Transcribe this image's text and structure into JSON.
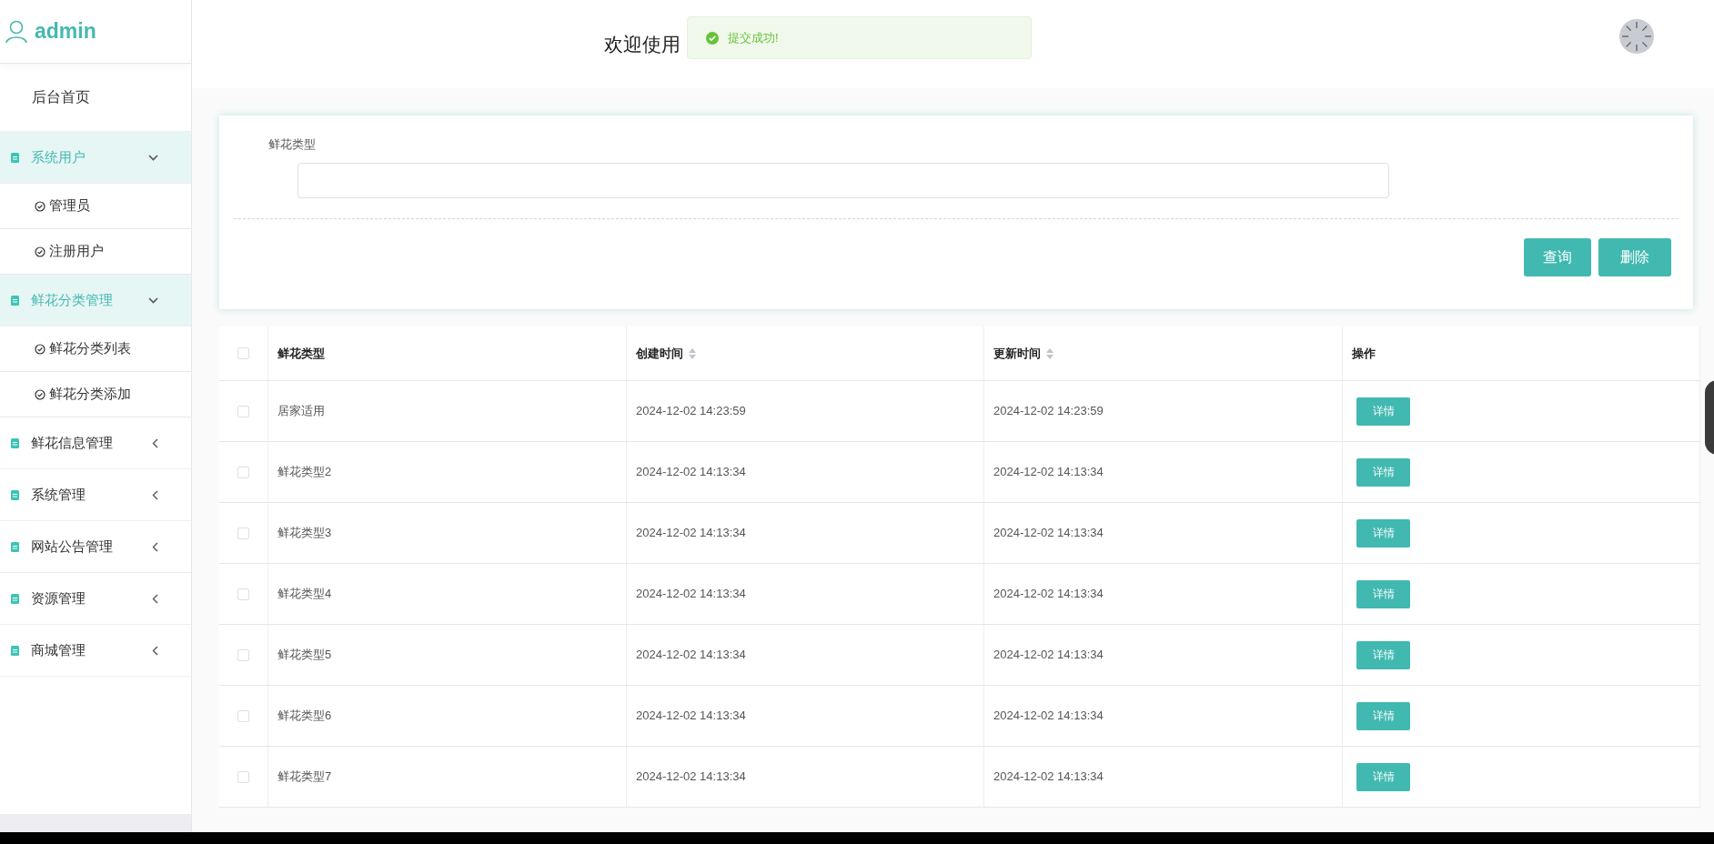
{
  "sidebar": {
    "user": "admin",
    "items": [
      {
        "label": "后台首页",
        "kind": "link"
      },
      {
        "label": "系统用户",
        "kind": "group",
        "expanded": true,
        "children": [
          {
            "label": "管理员"
          },
          {
            "label": "注册用户"
          }
        ]
      },
      {
        "label": "鲜花分类管理",
        "kind": "group",
        "expanded": true,
        "children": [
          {
            "label": "鲜花分类列表"
          },
          {
            "label": "鲜花分类添加"
          }
        ]
      },
      {
        "label": "鲜花信息管理",
        "kind": "group",
        "expanded": false
      },
      {
        "label": "系统管理",
        "kind": "group",
        "expanded": false
      },
      {
        "label": "网站公告管理",
        "kind": "group",
        "expanded": false
      },
      {
        "label": "资源管理",
        "kind": "group",
        "expanded": false
      },
      {
        "label": "商城管理",
        "kind": "group",
        "expanded": false
      }
    ]
  },
  "header": {
    "welcome": "欢迎使用",
    "toast": "提交成功!"
  },
  "search": {
    "label": "鲜花类型",
    "buttons": [
      "查询",
      "删除"
    ]
  },
  "table": {
    "all_checked": false,
    "columns": [
      {
        "label": "鲜花类型",
        "sortable": false
      },
      {
        "label": "创建时间",
        "sortable": true
      },
      {
        "label": "更新时间",
        "sortable": true
      },
      {
        "label": "操作",
        "sortable": false
      }
    ],
    "rows": [
      {
        "checked": false,
        "cells": [
          "居家适用",
          "2024-12-02 14:23:59",
          "2024-12-02 14:23:59"
        ],
        "action": "详情"
      },
      {
        "checked": false,
        "cells": [
          "鲜花类型2",
          "2024-12-02 14:13:34",
          "2024-12-02 14:13:34"
        ],
        "action": "详情"
      },
      {
        "checked": false,
        "cells": [
          "鲜花类型3",
          "2024-12-02 14:13:34",
          "2024-12-02 14:13:34"
        ],
        "action": "详情"
      },
      {
        "checked": false,
        "cells": [
          "鲜花类型4",
          "2024-12-02 14:13:34",
          "2024-12-02 14:13:34"
        ],
        "action": "详情"
      },
      {
        "checked": false,
        "cells": [
          "鲜花类型5",
          "2024-12-02 14:13:34",
          "2024-12-02 14:13:34"
        ],
        "action": "详情"
      },
      {
        "checked": false,
        "cells": [
          "鲜花类型6",
          "2024-12-02 14:13:34",
          "2024-12-02 14:13:34"
        ],
        "action": "详情"
      },
      {
        "checked": false,
        "cells": [
          "鲜花类型7",
          "2024-12-02 14:13:34",
          "2024-12-02 14:13:34"
        ],
        "action": "详情"
      }
    ]
  }
}
